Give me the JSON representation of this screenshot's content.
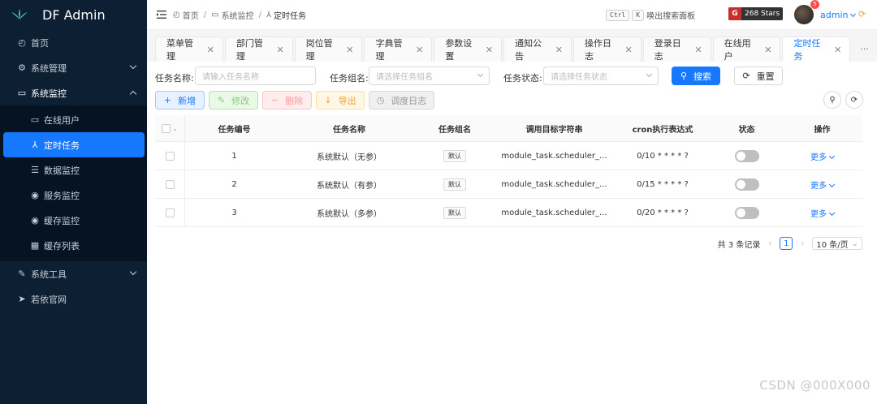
{
  "brand": {
    "name": "DF Admin"
  },
  "sidebar": {
    "items": [
      {
        "icon": "dashboard-icon",
        "label": "首页"
      },
      {
        "icon": "gear-icon",
        "label": "系统管理"
      },
      {
        "icon": "monitor-icon",
        "label": "系统监控"
      },
      {
        "icon": "tool-icon",
        "label": "系统工具"
      },
      {
        "icon": "send-icon",
        "label": "若依官网"
      }
    ],
    "sub_items": [
      {
        "icon": "desktop-icon",
        "label": "在线用户"
      },
      {
        "icon": "cluster-icon",
        "label": "定时任务"
      },
      {
        "icon": "list-icon",
        "label": "数据监控"
      },
      {
        "icon": "eye-icon",
        "label": "服务监控"
      },
      {
        "icon": "eye-icon",
        "label": "缓存监控"
      },
      {
        "icon": "table-icon",
        "label": "缓存列表"
      }
    ]
  },
  "header": {
    "breadcrumb": [
      "首页",
      "系统监控",
      "定时任务"
    ],
    "shortcut_keys": [
      "Ctrl",
      "K"
    ],
    "shortcut_label": "唤出搜索面板",
    "stars": "268 Stars",
    "badge_count": "5",
    "username": "admin"
  },
  "tabs": [
    "菜单管理",
    "部门管理",
    "岗位管理",
    "字典管理",
    "参数设置",
    "通知公告",
    "操作日志",
    "登录日志",
    "在线用户",
    "定时任务"
  ],
  "filters": {
    "task_name_label": "任务名称:",
    "task_name_placeholder": "请输入任务名称",
    "task_group_label": "任务组名:",
    "task_group_placeholder": "请选择任务组名",
    "task_status_label": "任务状态:",
    "task_status_placeholder": "请选择任务状态",
    "search_label": "搜索",
    "reset_label": "重置"
  },
  "toolbar": {
    "add": "新增",
    "edit": "修改",
    "delete": "删除",
    "export": "导出",
    "log": "调度日志"
  },
  "table": {
    "columns": [
      "任务编号",
      "任务名称",
      "任务组名",
      "调用目标字符串",
      "cron执行表达式",
      "状态",
      "操作"
    ],
    "rows": [
      {
        "id": "1",
        "name": "系统默认（无参）",
        "group": "默认",
        "target": "module_task.scheduler_...",
        "cron": "0/10 * * * * ?",
        "status": false,
        "action": "更多"
      },
      {
        "id": "2",
        "name": "系统默认（有参）",
        "group": "默认",
        "target": "module_task.scheduler_...",
        "cron": "0/15 * * * * ?",
        "status": false,
        "action": "更多"
      },
      {
        "id": "3",
        "name": "系统默认（多参）",
        "group": "默认",
        "target": "module_task.scheduler_...",
        "cron": "0/20 * * * * ?",
        "status": false,
        "action": "更多"
      }
    ]
  },
  "pagination": {
    "total_text": "共 3 条记录",
    "current_page": "1",
    "page_size": "10 条/页"
  },
  "watermark": "CSDN @000X000"
}
